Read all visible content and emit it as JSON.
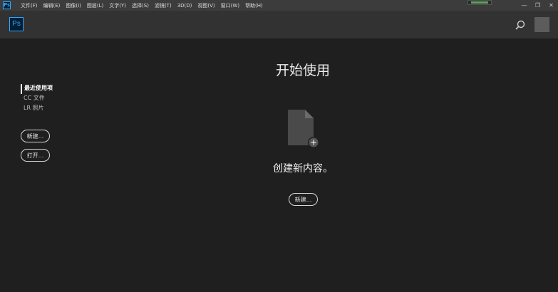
{
  "menubar": {
    "items": [
      "文件(F)",
      "编辑(E)",
      "图像(I)",
      "图层(L)",
      "文字(Y)",
      "选择(S)",
      "滤镜(T)",
      "3D(D)",
      "视图(V)",
      "窗口(W)",
      "帮助(H)"
    ],
    "window_controls": [
      "—",
      "❐",
      "✕"
    ]
  },
  "appbar": {
    "logo": "Ps"
  },
  "main": {
    "title": "开始使用",
    "create_text": "创建新内容。",
    "new_button": "新建..."
  },
  "sidebar": {
    "items": [
      "最近使用项",
      "CC 文件",
      "LR 照片"
    ],
    "new_button": "新建...",
    "open_button": "打开..."
  },
  "colors": {
    "accent": "#31a8ff",
    "background": "#1f1f1f",
    "appbar": "#323232",
    "menubar": "#3c3c3c"
  },
  "icons": {
    "search": "search-icon",
    "file": "new-file-icon",
    "plus": "plus-circle-icon"
  }
}
